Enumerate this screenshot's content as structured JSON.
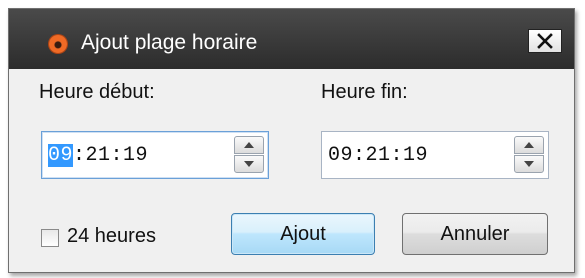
{
  "window": {
    "title": "Ajout plage horaire",
    "icon": "app-logo-icon",
    "close_icon": "close-icon"
  },
  "form": {
    "start_label": "Heure début:",
    "end_label": "Heure fin:",
    "start_time": {
      "selected": "09",
      "rest": ":21:19"
    },
    "end_time": "09:21:19",
    "checkbox_label": "24 heures",
    "checkbox_checked": false
  },
  "buttons": {
    "add": "Ajout",
    "cancel": "Annuler"
  },
  "colors": {
    "titlebar": "#2c2c2c",
    "selection": "#3399ff",
    "add_button_border": "#3c7fb1"
  }
}
